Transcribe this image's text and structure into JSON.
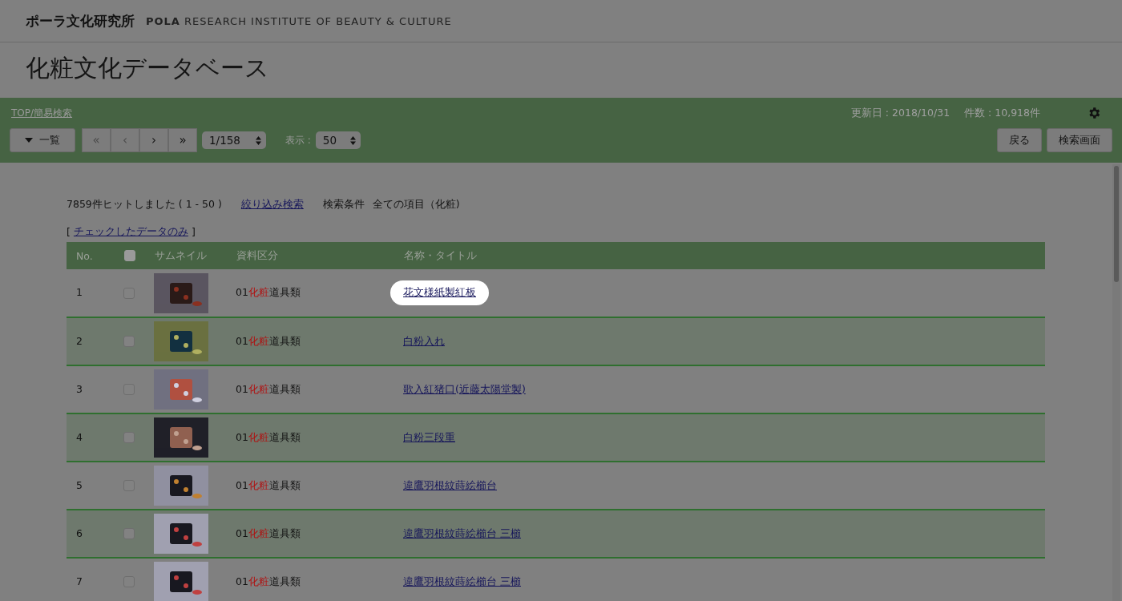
{
  "header": {
    "logo_ja": "ポーラ文化研究所",
    "logo_brand": "POLA",
    "logo_en": "RESEARCH INSTITUTE OF BEAUTY & CULTURE"
  },
  "page_title": "化粧文化データベース",
  "toolbar": {
    "breadcrumb": "TOP/簡易検索",
    "updated": "更新日 : 2018/10/31",
    "count": "件数 : 10,918件",
    "list_button": "一覧",
    "pager": [
      {
        "label": "«",
        "disabled": true
      },
      {
        "label": "‹",
        "disabled": true
      },
      {
        "label": "›",
        "disabled": false
      },
      {
        "label": "»",
        "disabled": false
      }
    ],
    "page_select": "1/158",
    "display_label": "表示 :",
    "display_select": "50",
    "back_button": "戻る",
    "search_button": "検索画面"
  },
  "results": {
    "summary": "7859件ヒットしました ( 1 - 50 )",
    "refine_link": "絞り込み検索",
    "condition_label": "検索条件",
    "condition": "全ての項目（化粧)",
    "checked_only_open": "[",
    "checked_only_link": "チェックしたデータのみ",
    "checked_only_close": "]"
  },
  "table": {
    "columns": [
      "No.",
      "",
      "サムネイル",
      "資料区分",
      "名称・タイトル"
    ],
    "header_checked": false,
    "rows": [
      {
        "no": "1",
        "checked": false,
        "category": {
          "prefix": "01",
          "match": "化粧",
          "suffix": "道具類"
        },
        "title": "花文様紙製紅板",
        "highlighted": true
      },
      {
        "no": "2",
        "checked": false,
        "category": {
          "prefix": "01",
          "match": "化粧",
          "suffix": "道具類"
        },
        "title": "白粉入れ",
        "highlighted": false
      },
      {
        "no": "3",
        "checked": false,
        "category": {
          "prefix": "01",
          "match": "化粧",
          "suffix": "道具類"
        },
        "title": "歌入紅猪口(近藤太陽堂製)",
        "highlighted": false
      },
      {
        "no": "4",
        "checked": false,
        "category": {
          "prefix": "01",
          "match": "化粧",
          "suffix": "道具類"
        },
        "title": "白粉三段重",
        "highlighted": false
      },
      {
        "no": "5",
        "checked": false,
        "category": {
          "prefix": "01",
          "match": "化粧",
          "suffix": "道具類"
        },
        "title": "違鷹羽根紋蒔絵櫛台",
        "highlighted": false
      },
      {
        "no": "6",
        "checked": false,
        "category": {
          "prefix": "01",
          "match": "化粧",
          "suffix": "道具類"
        },
        "title": "違鷹羽根紋蒔絵櫛台 三櫛",
        "highlighted": false
      },
      {
        "no": "7",
        "checked": false,
        "category": {
          "prefix": "01",
          "match": "化粧",
          "suffix": "道具類"
        },
        "title": "違鷹羽根紋蒔絵櫛台 三櫛",
        "highlighted": false
      }
    ]
  }
}
